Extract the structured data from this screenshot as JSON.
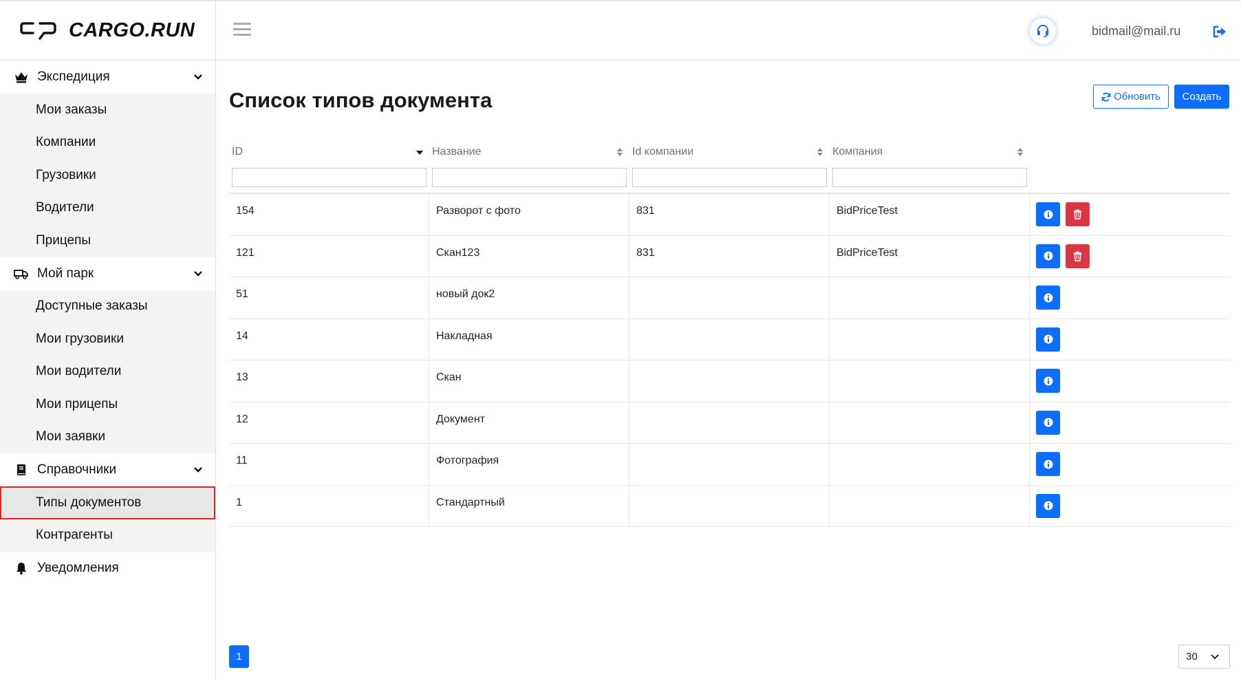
{
  "brand": {
    "name": "CARGO.RUN"
  },
  "topbar": {
    "user_email": "bidmail@mail.ru"
  },
  "sidebar": {
    "groups": [
      {
        "label": "Экспедиция",
        "icon": "crown-icon",
        "items": [
          "Мои заказы",
          "Компании",
          "Грузовики",
          "Водители",
          "Прицепы"
        ]
      },
      {
        "label": "Мой парк",
        "icon": "truck-icon",
        "items": [
          "Доступные заказы",
          "Мои грузовики",
          "Мои водители",
          "Мои прицепы",
          "Мои заявки"
        ]
      },
      {
        "label": "Справочники",
        "icon": "book-icon",
        "items": [
          "Типы документов",
          "Контрагенты"
        ]
      },
      {
        "label": "Уведомления",
        "icon": "bell-icon",
        "items": []
      }
    ],
    "active_item": "Типы документов"
  },
  "main": {
    "title": "Список типов документа",
    "refresh_label": "Обновить",
    "create_label": "Создать",
    "columns": [
      "ID",
      "Название",
      "Id компании",
      "Компания"
    ],
    "rows": [
      {
        "id": "154",
        "name": "Разворот с фото",
        "company_id": "831",
        "company": "BidPriceTest",
        "deletable": true
      },
      {
        "id": "121",
        "name": "Скан123",
        "company_id": "831",
        "company": "BidPriceTest",
        "deletable": true
      },
      {
        "id": "51",
        "name": "новый док2",
        "company_id": "",
        "company": "",
        "deletable": false
      },
      {
        "id": "14",
        "name": "Накладная",
        "company_id": "",
        "company": "",
        "deletable": false
      },
      {
        "id": "13",
        "name": "Скан",
        "company_id": "",
        "company": "",
        "deletable": false
      },
      {
        "id": "12",
        "name": "Документ",
        "company_id": "",
        "company": "",
        "deletable": false
      },
      {
        "id": "11",
        "name": "Фотография",
        "company_id": "",
        "company": "",
        "deletable": false
      },
      {
        "id": "1",
        "name": "Стандартный",
        "company_id": "",
        "company": "",
        "deletable": false
      }
    ],
    "pagination": {
      "current_page": "1",
      "page_size": "30"
    }
  },
  "colors": {
    "primary": "#0d6efd",
    "danger": "#dc3545",
    "active_outline": "#e02424"
  }
}
